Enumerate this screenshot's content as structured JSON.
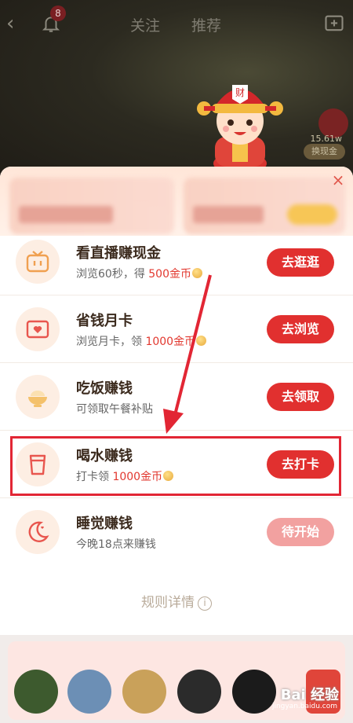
{
  "nav": {
    "notification_count": "8",
    "tab_follow": "关注",
    "tab_recommend": "推荐"
  },
  "live": {
    "fans": "15.61w",
    "exchange_label": "换现金"
  },
  "tasks": [
    {
      "title": "看直播赚现金",
      "sub_prefix": "浏览60秒，得 ",
      "reward": "500金币",
      "button": "去逛逛",
      "icon": "tv-icon",
      "state": "active"
    },
    {
      "title": "省钱月卡",
      "sub_prefix": "浏览月卡，领 ",
      "reward": "1000金币",
      "button": "去浏览",
      "icon": "heart-card-icon",
      "state": "active"
    },
    {
      "title": "吃饭赚钱",
      "sub_prefix": "可领取午餐补贴",
      "reward": "",
      "button": "去领取",
      "icon": "rice-bowl-icon",
      "state": "active"
    },
    {
      "title": "喝水赚钱",
      "sub_prefix": "打卡领 ",
      "reward": "1000金币",
      "button": "去打卡",
      "icon": "cup-icon",
      "state": "active"
    },
    {
      "title": "睡觉赚钱",
      "sub_prefix": "今晚18点来赚钱",
      "reward": "",
      "button": "待开始",
      "icon": "moon-icon",
      "state": "pending"
    }
  ],
  "rules_label": "规则详情",
  "watermark": "Bai 经验",
  "watermark_sub": "jingyan.baidu.com",
  "colors": {
    "accent_red": "#e1302f",
    "pending_red": "#f2a1a0",
    "highlight": "#e22634"
  }
}
